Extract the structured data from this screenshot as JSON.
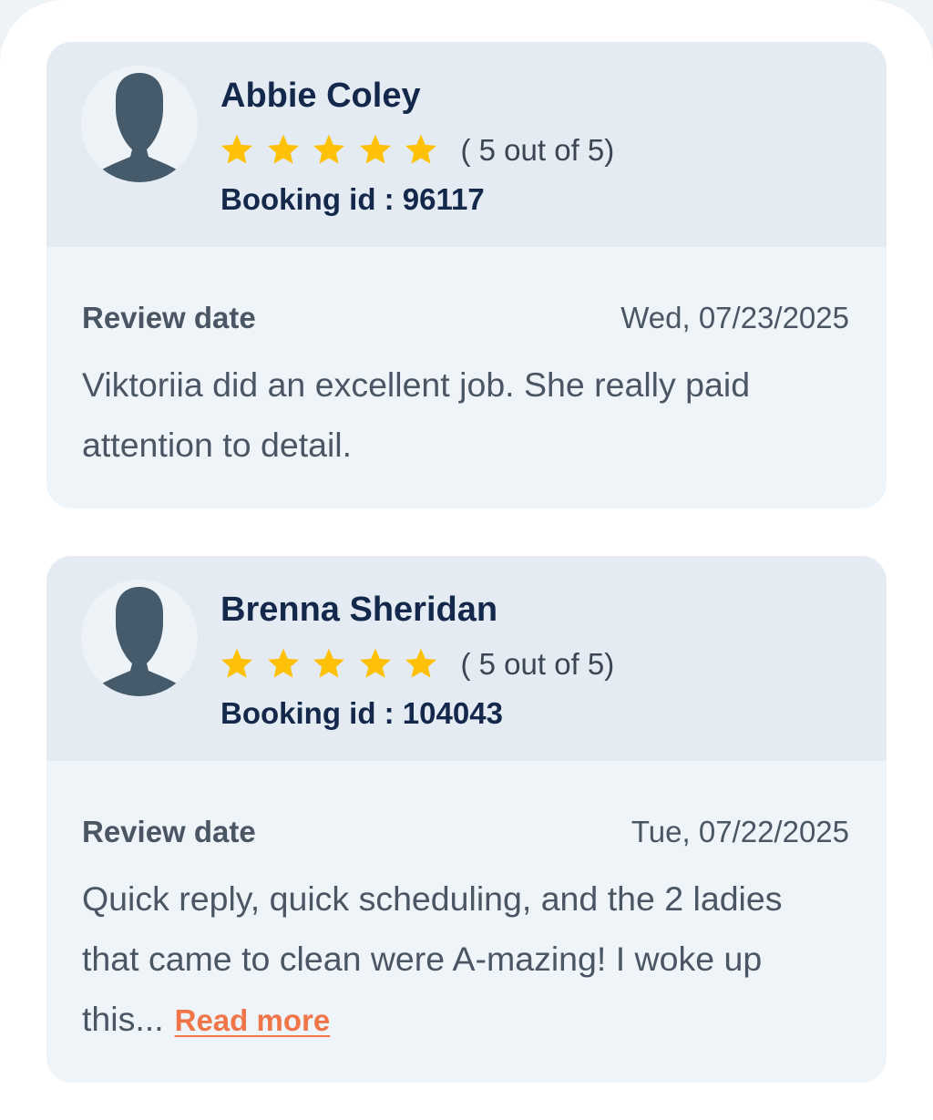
{
  "reviews": [
    {
      "name": "Abbie Coley",
      "stars": 5,
      "rating_text": "( 5 out of 5)",
      "booking_id": "Booking id : 96117",
      "review_date_label": "Review date",
      "review_date": "Wed, 07/23/2025",
      "text": "Viktoriia did an excellent job. She really paid attention to detail.",
      "read_more_label": ""
    },
    {
      "name": "Brenna Sheridan",
      "stars": 5,
      "rating_text": "( 5 out of 5)",
      "booking_id": "Booking id : 104043",
      "review_date_label": "Review date",
      "review_date": "Tue, 07/22/2025",
      "text": "Quick reply, quick scheduling, and the 2 ladies that came to clean were A-mazing! I woke up this...",
      "read_more_label": "Read more"
    }
  ],
  "icons": {
    "avatar": "person-silhouette-icon",
    "star": "star-icon"
  },
  "colors": {
    "star": "#ffc107",
    "avatar_silhouette": "#455a6a",
    "read_more": "#f0764a",
    "name": "#13284a"
  }
}
